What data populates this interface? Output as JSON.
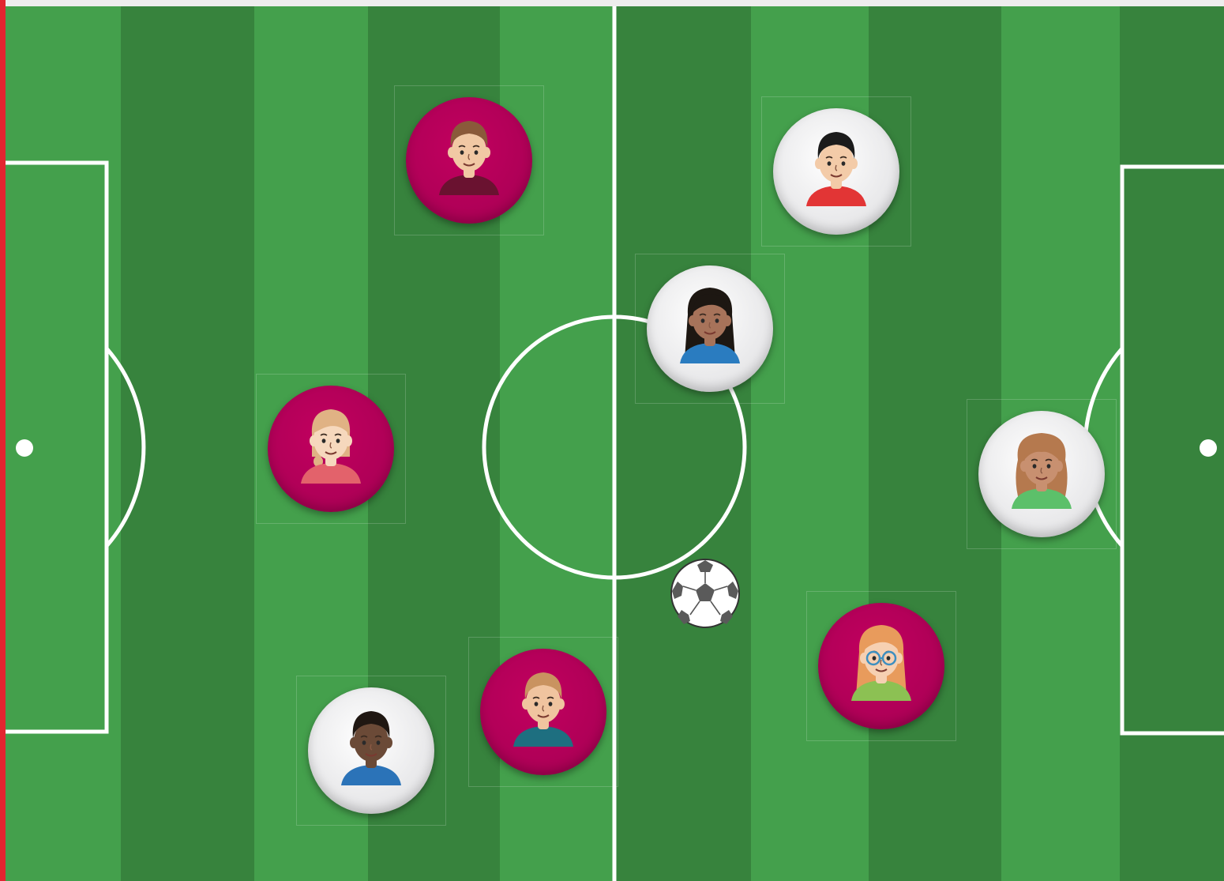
{
  "game": {
    "view": "soccer-lineup-board",
    "colors": {
      "stripe_light": "#44a04c",
      "stripe_dark": "#37833d",
      "line": "#ffffff",
      "team_a": "#ad0056",
      "team_b": "#e5e5e7",
      "edge_accent": "#e22530"
    }
  },
  "players": [
    {
      "id": "p1",
      "team": "a",
      "hair": "#8a5a3a",
      "skin": "#f1c8a4",
      "shirt": "#6a1230",
      "style": "short"
    },
    {
      "id": "p2",
      "team": "b",
      "hair": "#1b1b1b",
      "skin": "#f3cba8",
      "shirt": "#e23535",
      "style": "short"
    },
    {
      "id": "p3",
      "team": "b",
      "hair": "#1d1712",
      "skin": "#a7735a",
      "shirt": "#2a7cc0",
      "style": "long"
    },
    {
      "id": "p4",
      "team": "a",
      "hair": "#e0b284",
      "skin": "#f6d8bd",
      "shirt": "#e3626b",
      "style": "braid"
    },
    {
      "id": "p5",
      "team": "b",
      "hair": "#b5794e",
      "skin": "#c89070",
      "shirt": "#5cc06a",
      "style": "curly"
    },
    {
      "id": "p6",
      "team": "a",
      "hair": "#e89b5c",
      "skin": "#f6d0b2",
      "shirt": "#8cc153",
      "style": "long-glasses"
    },
    {
      "id": "p7",
      "team": "a",
      "hair": "#c99360",
      "skin": "#f0c49f",
      "shirt": "#1e6f80",
      "style": "short"
    },
    {
      "id": "p8",
      "team": "b",
      "hair": "#1f1712",
      "skin": "#6b4a37",
      "shirt": "#2b73b8",
      "style": "short"
    }
  ],
  "ball": {
    "icon": "soccer-ball-icon"
  }
}
